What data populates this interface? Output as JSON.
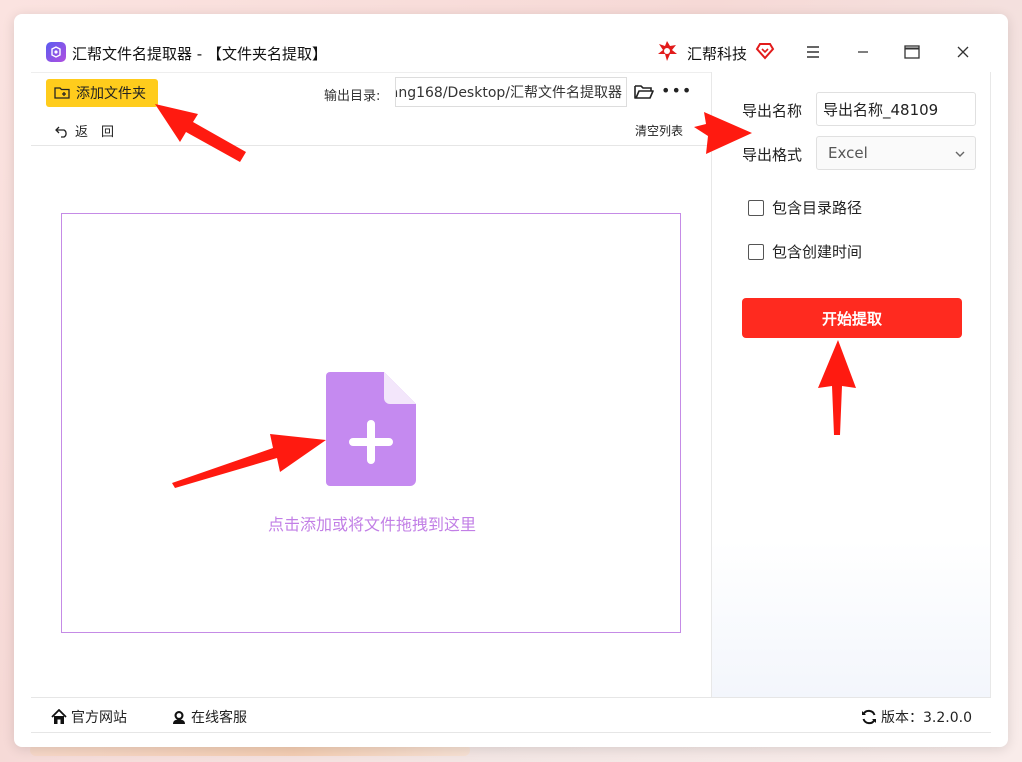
{
  "window": {
    "title": "汇帮文件名提取器 - 【文件夹名提取】",
    "brand": "汇帮科技"
  },
  "toolbar": {
    "add_folder_label": "添加文件夹",
    "output_dir_label": "输出目录:",
    "output_dir_value": "ang168/Desktop/汇帮文件名提取器",
    "back_label": "返　回",
    "clear_list_label": "清空列表"
  },
  "dropzone": {
    "hint": "点击添加或将文件拖拽到这里"
  },
  "settings": {
    "export_name_label": "导出名称",
    "export_name_value": "导出名称_48109",
    "export_format_label": "导出格式",
    "export_format_value": "Excel",
    "include_path_label": "包含目录路径",
    "include_path_checked": false,
    "include_created_label": "包含创建时间",
    "include_created_checked": false,
    "start_label": "开始提取"
  },
  "statusbar": {
    "site_label": "官方网站",
    "service_label": "在线客服",
    "version_label": "版本：3.2.0.0"
  },
  "colors": {
    "accent_yellow": "#ffcc1c",
    "start_red": "#ff2a1f",
    "dropzone_purple": "#c27fe6",
    "annotation_red": "#ff1a10"
  }
}
